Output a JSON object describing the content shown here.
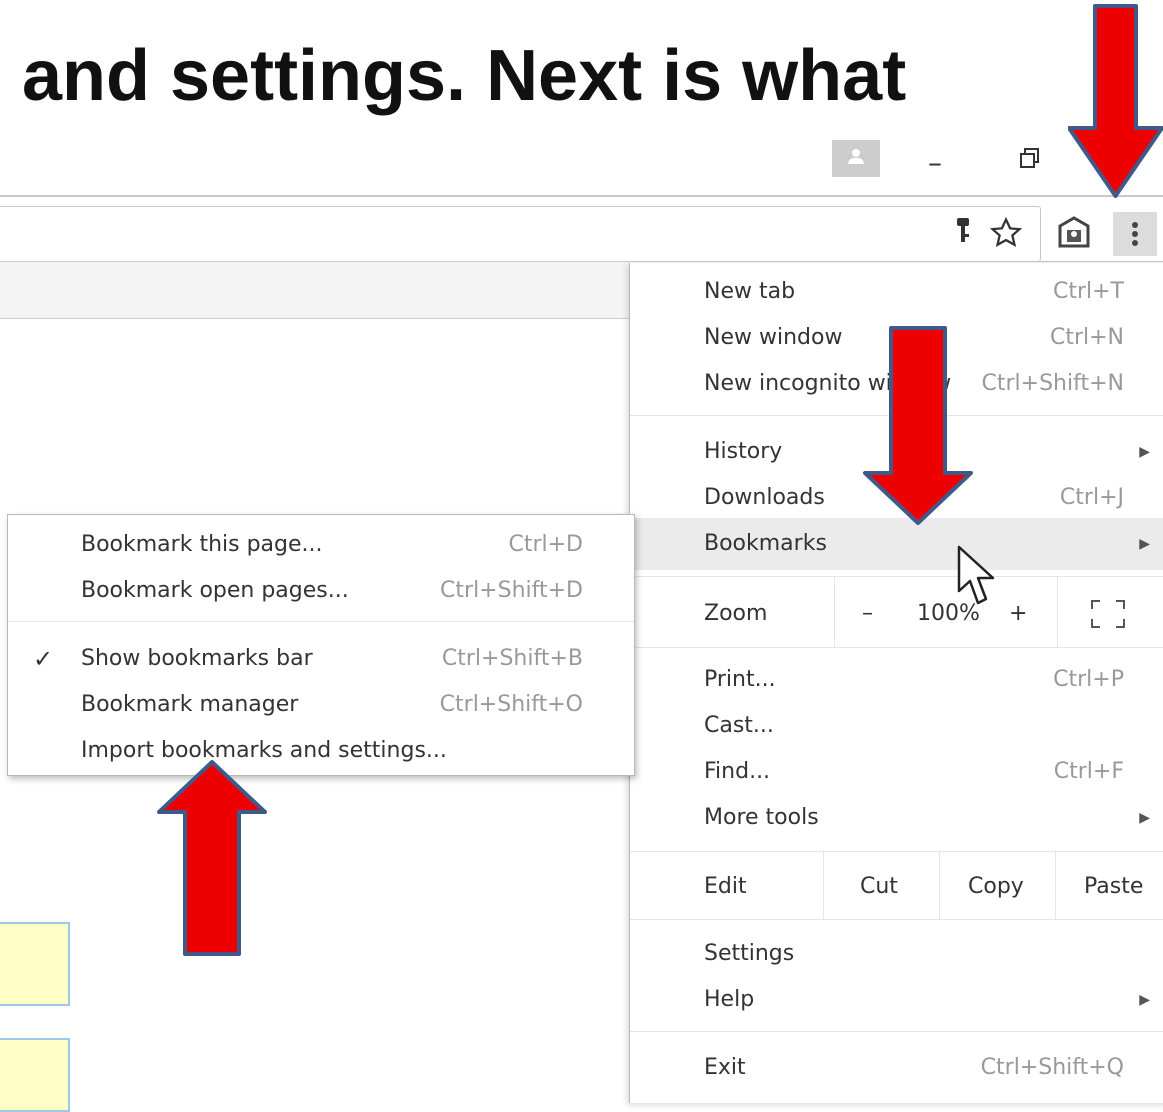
{
  "slide": {
    "caption": "and settings.  Next is what"
  },
  "toolbar": {
    "key_icon": "key-icon",
    "star_icon": "star-icon",
    "extension_icon": "extension-icon",
    "menu_icon": "three-dots-menu-icon"
  },
  "window_controls": {
    "minimize": "–",
    "restore": "🗗"
  },
  "main_menu": {
    "items": [
      {
        "label": "New tab",
        "shortcut": "Ctrl+T"
      },
      {
        "label": "New window",
        "shortcut": "Ctrl+N"
      },
      {
        "label": "New incognito window",
        "shortcut": "Ctrl+Shift+N"
      },
      {
        "label": "History",
        "shortcut": ""
      },
      {
        "label": "Downloads",
        "shortcut": "Ctrl+J"
      },
      {
        "label": "Bookmarks",
        "shortcut": ""
      },
      {
        "label": "Print...",
        "shortcut": "Ctrl+P"
      },
      {
        "label": "Cast...",
        "shortcut": ""
      },
      {
        "label": "Find...",
        "shortcut": "Ctrl+F"
      },
      {
        "label": "More tools",
        "shortcut": ""
      },
      {
        "label": "Settings",
        "shortcut": ""
      },
      {
        "label": "Help",
        "shortcut": ""
      },
      {
        "label": "Exit",
        "shortcut": "Ctrl+Shift+Q"
      }
    ],
    "zoom": {
      "label": "Zoom",
      "minus": "–",
      "value": "100%",
      "plus": "+"
    },
    "edit": {
      "label": "Edit",
      "cut": "Cut",
      "copy": "Copy",
      "paste": "Paste"
    }
  },
  "bookmarks_submenu": {
    "items": [
      {
        "label": "Bookmark this page...",
        "shortcut": "Ctrl+D"
      },
      {
        "label": "Bookmark open pages...",
        "shortcut": "Ctrl+Shift+D"
      },
      {
        "label": "Show bookmarks bar",
        "shortcut": "Ctrl+Shift+B",
        "checked": true
      },
      {
        "label": "Bookmark manager",
        "shortcut": "Ctrl+Shift+O"
      },
      {
        "label": "Import bookmarks and settings...",
        "shortcut": ""
      }
    ]
  },
  "colors": {
    "arrow_fill": "#ee0000",
    "arrow_outline": "#3f5a8a",
    "menu_highlight": "#ebebeb"
  }
}
